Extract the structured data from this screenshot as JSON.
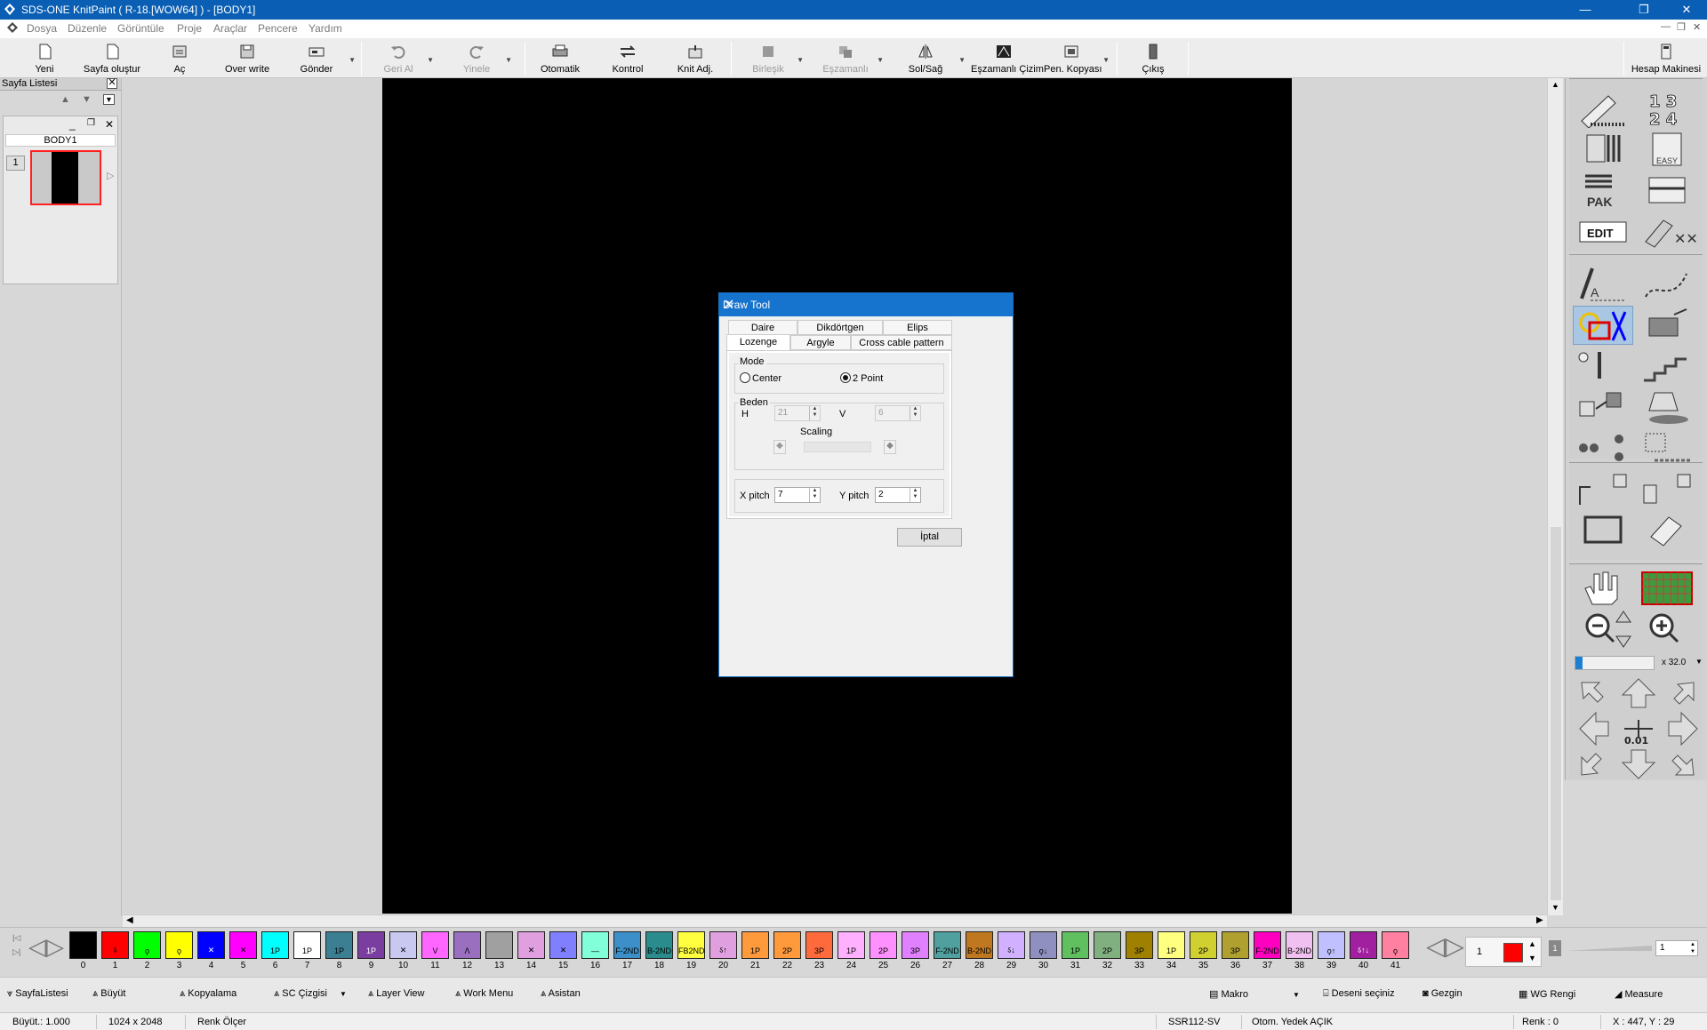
{
  "window": {
    "title": "SDS-ONE KnitPaint ( R-18.[WOW64] ) - [BODY1]"
  },
  "menu": [
    "Dosya",
    "Düzenle",
    "Görüntüle",
    "Proje",
    "Araçlar",
    "Pencere",
    "Yardım"
  ],
  "toolbar": {
    "yeni": "Yeni",
    "sayfa": "Sayfa oluştur",
    "ac": "Aç",
    "overwrite": "Over write",
    "gonder": "Gönder",
    "geri": "Geri Al",
    "yinele": "Yinele",
    "otomatik": "Otomatik",
    "kontrol": "Kontrol",
    "knit": "Knit Adj.",
    "birlesik": "Birleşik",
    "eszamanli": "Eşzamanlı",
    "solsag": "Sol/Sağ",
    "eszcizim": "Eşzamanlı Çizim",
    "penkopya": "Pen. Kopyası",
    "cikis": "Çıkış",
    "hesap": "Hesap Makinesi"
  },
  "page_list": {
    "title": "Sayfa Listesi",
    "page_name": "BODY1",
    "page_number": "1"
  },
  "dialog": {
    "title": "Draw Tool",
    "tabs_row1": [
      "Daire",
      "Dikdörtgen",
      "Elips"
    ],
    "tabs_row2": [
      "Lozenge",
      "Argyle",
      "Cross cable pattern"
    ],
    "active_tab": "Lozenge",
    "mode_label": "Mode",
    "center_label": "Center",
    "two_point_label": "2 Point",
    "mode_selected": "2 Point",
    "beden_label": "Beden",
    "h_label": "H",
    "h_value": "21",
    "v_label": "V",
    "v_value": "6",
    "scaling_label": "Scaling",
    "xpitch_label": "X pitch",
    "xpitch_value": "7",
    "ypitch_label": "Y pitch",
    "ypitch_value": "2",
    "cancel": "İptal"
  },
  "right_panel": {
    "zoom": "x 32.0",
    "step": "0.01"
  },
  "palette": {
    "colors": [
      {
        "n": "0",
        "c": "#000000",
        "t": ""
      },
      {
        "n": "1",
        "c": "#ff0000",
        "t": "ऽ"
      },
      {
        "n": "2",
        "c": "#00ff00",
        "t": "ϙ"
      },
      {
        "n": "3",
        "c": "#ffff00",
        "t": "ϙ"
      },
      {
        "n": "4",
        "c": "#0000ff",
        "t": "✕"
      },
      {
        "n": "5",
        "c": "#ff00ff",
        "t": "✕"
      },
      {
        "n": "6",
        "c": "#00ffff",
        "t": "1P"
      },
      {
        "n": "7",
        "c": "#ffffff",
        "t": "1P"
      },
      {
        "n": "8",
        "c": "#3c7f93",
        "t": "1P"
      },
      {
        "n": "9",
        "c": "#7a3da0",
        "t": "1P"
      },
      {
        "n": "10",
        "c": "#c8c8f0",
        "t": "✕"
      },
      {
        "n": "11",
        "c": "#ff66ff",
        "t": "V"
      },
      {
        "n": "12",
        "c": "#9a6fc0",
        "t": "Λ"
      },
      {
        "n": "13",
        "c": "#a0a0a0",
        "t": ""
      },
      {
        "n": "14",
        "c": "#e0a0e0",
        "t": "✕"
      },
      {
        "n": "15",
        "c": "#8080ff",
        "t": "✕"
      },
      {
        "n": "16",
        "c": "#80ffd8",
        "t": "—"
      },
      {
        "n": "17",
        "c": "#3c8fc8",
        "t": "F-2ND"
      },
      {
        "n": "18",
        "c": "#2a8c8c",
        "t": "B-2ND"
      },
      {
        "n": "19",
        "c": "#ffff40",
        "t": "FB2ND"
      },
      {
        "n": "20",
        "c": "#e0a0e0",
        "t": "ऽ↑"
      },
      {
        "n": "21",
        "c": "#ff9a3c",
        "t": "1P"
      },
      {
        "n": "22",
        "c": "#ff9a3c",
        "t": "2P"
      },
      {
        "n": "23",
        "c": "#ff6a3c",
        "t": "3P"
      },
      {
        "n": "24",
        "c": "#ffb0ff",
        "t": "1P"
      },
      {
        "n": "25",
        "c": "#ff90ff",
        "t": "2P"
      },
      {
        "n": "26",
        "c": "#e080ff",
        "t": "3P"
      },
      {
        "n": "27",
        "c": "#50a0a0",
        "t": "F-2ND"
      },
      {
        "n": "28",
        "c": "#c07820",
        "t": "B-2ND"
      },
      {
        "n": "29",
        "c": "#d0b0ff",
        "t": "ऽ↓"
      },
      {
        "n": "30",
        "c": "#9090c0",
        "t": "ϙ↓"
      },
      {
        "n": "31",
        "c": "#60c060",
        "t": "1P"
      },
      {
        "n": "32",
        "c": "#80b080",
        "t": "2P"
      },
      {
        "n": "33",
        "c": "#a08000",
        "t": "3P"
      },
      {
        "n": "34",
        "c": "#ffff80",
        "t": "1P"
      },
      {
        "n": "35",
        "c": "#d0d030",
        "t": "2P"
      },
      {
        "n": "36",
        "c": "#b0a030",
        "t": "3P"
      },
      {
        "n": "37",
        "c": "#ff00c0",
        "t": "F-2ND"
      },
      {
        "n": "38",
        "c": "#f0c0f0",
        "t": "B-2ND"
      },
      {
        "n": "39",
        "c": "#c0c0ff",
        "t": "ϙ↑"
      },
      {
        "n": "40",
        "c": "#a020a0",
        "t": "ऽ↑↓"
      },
      {
        "n": "41",
        "c": "#ff80a0",
        "t": "ϙ"
      }
    ],
    "current_value": "1",
    "step_value": "1",
    "selected_color": "#ff0000"
  },
  "bottom_bar": {
    "sayfalistesi": "SayfaListesi",
    "buyut": "Büyüt",
    "kopyalama": "Kopyalama",
    "sc": "SC Çizgisi",
    "layer": "Layer View",
    "workmenu": "Work Menu",
    "asistan": "Asistan",
    "makro": "Makro",
    "deseni": "Deseni seçiniz",
    "gezgin": "Gezgin",
    "wg": "WG Rengi",
    "measure": "Measure"
  },
  "status": {
    "buyut": "Büyüt.: 1.000",
    "size": "1024 x 2048",
    "renk": "Renk Ölçer",
    "model": "SSR112-SV",
    "yedek": "Otom. Yedek AÇIK",
    "renk_no": "Renk :  0",
    "coords": "X : 447, Y :  29"
  }
}
